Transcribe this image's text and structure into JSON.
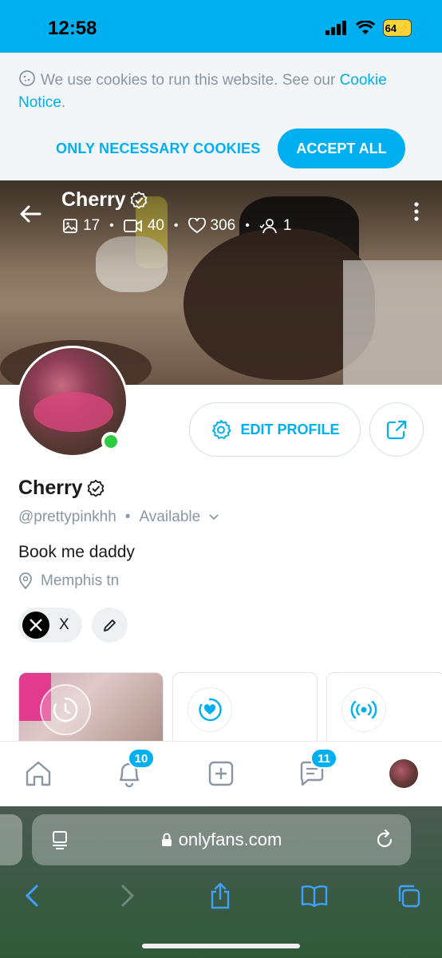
{
  "status_bar": {
    "time": "12:58",
    "battery": "64"
  },
  "cookie_banner": {
    "text": "We use cookies to run this website. See our",
    "link": "Cookie Notice",
    "after_link": ".",
    "necessary_label": "ONLY NECESSARY COOKIES",
    "accept_label": "ACCEPT ALL"
  },
  "header": {
    "name": "Cherry",
    "stats": {
      "photos": "17",
      "videos": "40",
      "likes": "306",
      "subscribers": "1"
    },
    "separator": "•"
  },
  "profile": {
    "edit_label": "EDIT PROFILE",
    "name": "Cherry",
    "handle": "@prettypinkhh",
    "separator": "•",
    "availability": "Available",
    "bio": "Book me daddy",
    "location": "Memphis tn",
    "social_label": "X"
  },
  "bottom_nav": {
    "notifications_count": "10",
    "messages_count": "11"
  },
  "browser": {
    "url": "onlyfans.com"
  },
  "colors": {
    "accent": "#00aff0",
    "online": "#2ecc40",
    "muted": "#8a96a3"
  }
}
